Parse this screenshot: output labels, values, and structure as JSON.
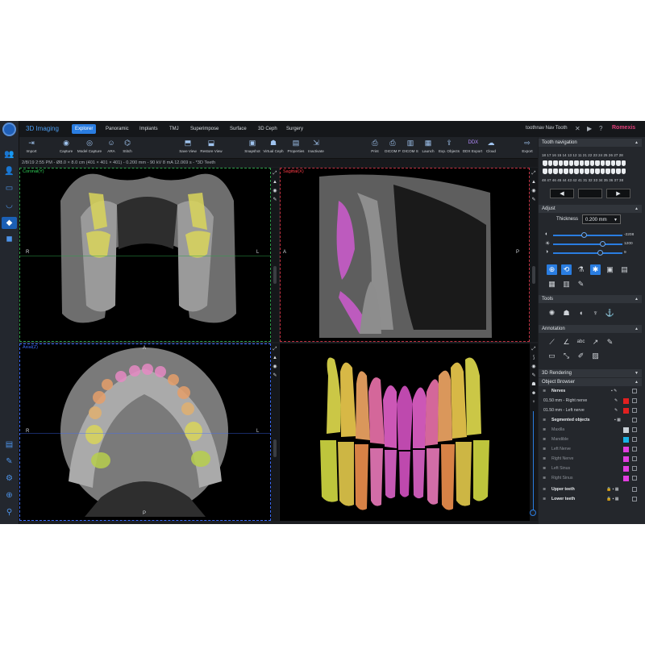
{
  "app": {
    "module_title": "3D Imaging",
    "tabs": [
      "Explorer",
      "Panoramic",
      "Implants",
      "TMJ",
      "Superimpose",
      "Surface",
      "3D Ceph",
      "Surgery"
    ],
    "active_tab": "Explorer",
    "window_title": "toothnav Nav Tooth",
    "brand": "Romexis",
    "accent_color": "#2a7de1",
    "brand_color": "#e0407a"
  },
  "toolbar": {
    "import": "Import",
    "capture": "Capture",
    "model_capture": "Model Capture",
    "ara": "ARA",
    "stitch": "Stitch",
    "save_view": "Save View",
    "restore_view": "Restore View",
    "snapshot": "Snapshot",
    "virtual_ceph": "Virtual Ceph",
    "properties": "Properties",
    "inactivate": "Inactivate",
    "print": "Print",
    "dicom_p": "DICOM P",
    "dicom_s": "DICOM S",
    "launch": "Launch",
    "exp_objects": "Exp. Objects",
    "ddx_export": "DDX Export",
    "cloud": "Cloud",
    "export": "Export"
  },
  "info_bar": "2/8/19 2:55 PM - Ø8.0 × 8.0 cm (401 × 401 × 401) - 0.200 mm - 90 kV 8 mA 12.069 s - *3D Teeth",
  "views": {
    "coronal": {
      "label": "Coronal(Y)",
      "color": "#30d158",
      "left": "R",
      "right": "L"
    },
    "sagittal": {
      "label": "Sagittal(X)",
      "color": "#ff3b46",
      "left": "A",
      "right": "P"
    },
    "axial": {
      "label": "Axial(Z)",
      "color": "#3b6cff",
      "left": "R",
      "right": "L",
      "top": "A",
      "bottom": "P"
    }
  },
  "tooth_navigation": {
    "title": "Tooth navigation",
    "upper_numbers": "18 17 16 15 14 13 12 11 21 22 23 24 25 26 27 28",
    "lower_numbers": "48 47 46 45 44 43 42 41 31 32 33 34 35 36 37 38",
    "prev": "◀",
    "next": "▶"
  },
  "adjust": {
    "title": "Adjust",
    "thickness_label": "Thickness",
    "thickness_value": "0.200 mm",
    "contrast_value": 0.45,
    "brightness_value": 0.72,
    "gamma_value": 0.68,
    "slider1_value": "-2208",
    "slider2_value": "1200",
    "slider3_value": "9"
  },
  "tools_title": "Tools",
  "annotation_title": "Annotation",
  "rendering_title": "3D Rendering",
  "object_browser": {
    "title": "Object Browser",
    "nerves_label": "Nerves",
    "right_nerve": "01.50 mm - Right nerve",
    "left_nerve": "01.50 mm - Left nerve",
    "segmented_label": "Segmented objects",
    "items": [
      {
        "name": "Maxilla",
        "color": "#c8cfd6"
      },
      {
        "name": "Mandible",
        "color": "#19b3e6"
      },
      {
        "name": "Left Nerve",
        "color": "#e23ee0"
      },
      {
        "name": "Right Nerve",
        "color": "#e23ee0"
      },
      {
        "name": "Left Sinus",
        "color": "#e23ee0"
      },
      {
        "name": "Right Sinus",
        "color": "#e23ee0"
      }
    ],
    "upper_teeth": "Upper teeth",
    "lower_teeth": "Lower teeth"
  }
}
